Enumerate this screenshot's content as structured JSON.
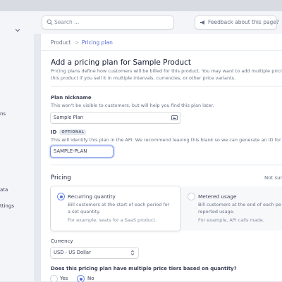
{
  "sidebar": {
    "fragments": [
      "ns",
      "ata",
      "ttings"
    ]
  },
  "topbar": {
    "search_placeholder": "Search ...",
    "feedback_label": "Feedback about this page?"
  },
  "breadcrumb": {
    "product": "Product",
    "separator": ">",
    "current": "Pricing plan"
  },
  "header": {
    "title": "Add a pricing plan for Sample Product",
    "description_line1": "Pricing plans define how customers will be billed for this product. You may want to add multiple pricing",
    "description_line2": "this product if you sell it in multiple intervals, currencies, or other price variants."
  },
  "nickname": {
    "label": "Plan nickname",
    "help": "This won't be visible to customers, but will help you find this plan later.",
    "value": "Sample Plan"
  },
  "plan_id": {
    "label": "ID",
    "badge": "OPTIONAL",
    "help": "This will identify this plan in the API. We recommend leaving this blank so we can generate an ID for yo",
    "value": "SAMPLE-PLAN"
  },
  "pricing": {
    "title": "Pricing",
    "not_sure": "Not sure",
    "options": [
      {
        "title": "Recurring quantity",
        "description": "Bill customers at the start of each period for a set quantity.",
        "example": "For example, seats for a SaaS product.",
        "selected": true
      },
      {
        "title": "Metered usage",
        "description_line1": "Bill customers at the end of each pe",
        "description_line2": "reported usage.",
        "example": "For example, API calls made.",
        "selected": false
      }
    ]
  },
  "currency": {
    "label": "Currency",
    "value": "USD - US Dollar"
  },
  "tiers": {
    "question": "Does this pricing plan have multiple price tiers based on quantity?",
    "yes_label": "Yes",
    "no_label": "No",
    "selected": "No"
  },
  "colors": {
    "accent": "#5469d4",
    "text": "#3c4257",
    "muted": "#697386"
  }
}
